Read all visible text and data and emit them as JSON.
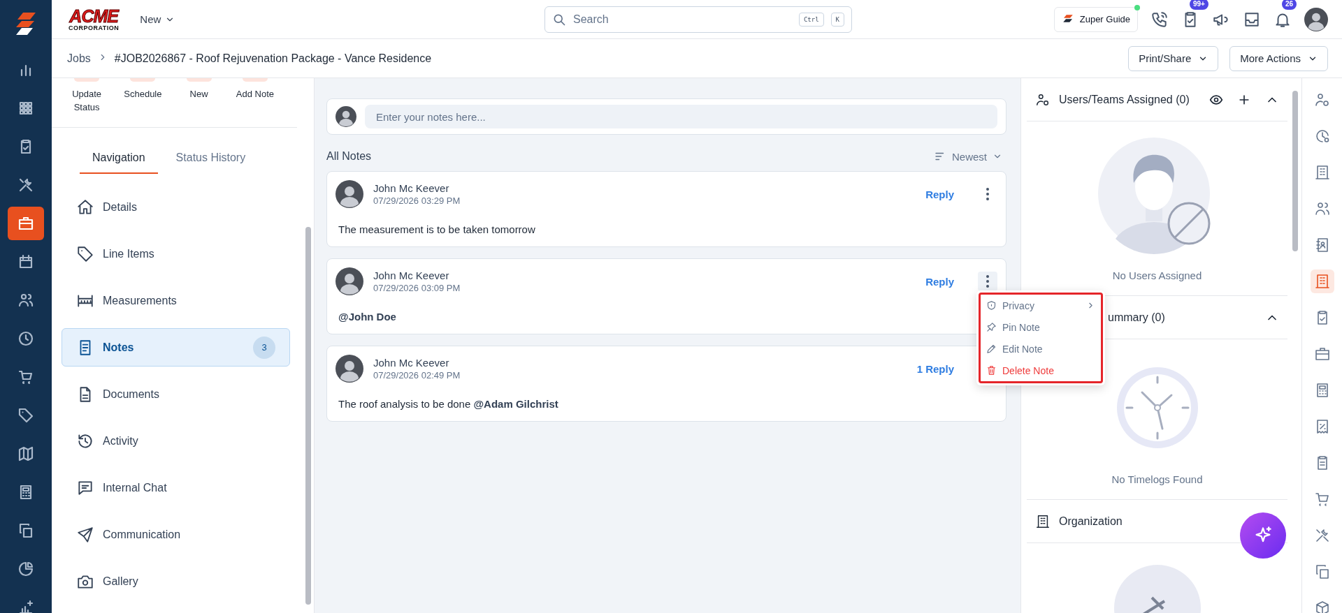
{
  "logo": {
    "name": "ACME",
    "tagline": "CORPORATION"
  },
  "rail": [
    {
      "selected": false
    },
    {
      "selected": false
    },
    {
      "selected": false
    },
    {
      "selected": false
    },
    {
      "selected": true
    },
    {
      "selected": false
    },
    {
      "selected": false
    },
    {
      "selected": false
    },
    {
      "selected": false
    },
    {
      "selected": false
    },
    {
      "selected": false
    },
    {
      "selected": false
    },
    {
      "selected": false
    },
    {
      "selected": false
    },
    {
      "selected": false
    }
  ],
  "top_bar": {
    "new_menu": "New",
    "search": {
      "placeholder": "Search",
      "keys": [
        "Ctrl",
        "K"
      ]
    },
    "guide": "Zuper Guide",
    "task_count": "99+",
    "notification_count": "26"
  },
  "breadcrumb": {
    "parent": "Jobs",
    "current": "#JOB2026867 - Roof Rejuvenation Package - Vance Residence"
  },
  "actions": [
    "Print/Share",
    "More Actions"
  ],
  "quick_actions": [
    "Update Status",
    "Schedule",
    "New",
    "Add Note"
  ],
  "panel_tabs": [
    {
      "label": "Navigation",
      "selected": true
    },
    {
      "label": "Status History",
      "selected": false
    }
  ],
  "nav": [
    {
      "label": "Details",
      "selected": false
    },
    {
      "label": "Line Items",
      "selected": false
    },
    {
      "label": "Measurements",
      "selected": false
    },
    {
      "label": "Notes",
      "selected": true,
      "count": "3"
    },
    {
      "label": "Documents",
      "selected": false
    },
    {
      "label": "Activity",
      "selected": false
    },
    {
      "label": "Internal Chat",
      "selected": false
    },
    {
      "label": "Communication",
      "selected": false
    },
    {
      "label": "Gallery",
      "selected": false
    }
  ],
  "notes": {
    "placeholder": "Enter your notes here...",
    "heading": "All Notes",
    "sort": "Newest",
    "items": [
      {
        "author": "John Mc Keever",
        "time": "07/29/2026 03:29 PM",
        "reply": "Reply",
        "text": "The measurement is to be taken tomorrow",
        "menu_open": false
      },
      {
        "author": "John Mc Keever",
        "time": "07/29/2026 03:09 PM",
        "reply": "Reply",
        "mention": "@John Doe",
        "menu_open": true
      },
      {
        "author": "John Mc Keever",
        "time": "07/29/2026 02:49 PM",
        "reply": "1 Reply",
        "text": "The roof analysis to be done",
        "mention": "@Adam Gilchrist",
        "menu_open": false
      }
    ]
  },
  "note_menu": [
    {
      "label": "Privacy",
      "kind": "normal",
      "submenu": true
    },
    {
      "label": "Pin Note",
      "kind": "normal",
      "submenu": false
    },
    {
      "label": "Edit Note",
      "kind": "normal",
      "submenu": false
    },
    {
      "label": "Delete Note",
      "kind": "danger",
      "submenu": false
    }
  ],
  "right_sections": [
    {
      "kind": "users",
      "title": "Users/Teams Assigned (0)",
      "empty": "No Users Assigned"
    },
    {
      "kind": "timelogs",
      "title": "ummary (0)",
      "empty": "No Timelogs Found"
    },
    {
      "kind": "organization",
      "title": "Organization"
    }
  ],
  "right_strip": [
    {
      "selected": false
    },
    {
      "selected": false
    },
    {
      "selected": false
    },
    {
      "selected": false
    },
    {
      "selected": false
    },
    {
      "selected": true
    },
    {
      "selected": false
    },
    {
      "selected": false
    },
    {
      "selected": false
    },
    {
      "selected": false
    },
    {
      "selected": false
    },
    {
      "selected": false
    },
    {
      "selected": false
    },
    {
      "selected": false
    },
    {
      "selected": false
    }
  ]
}
